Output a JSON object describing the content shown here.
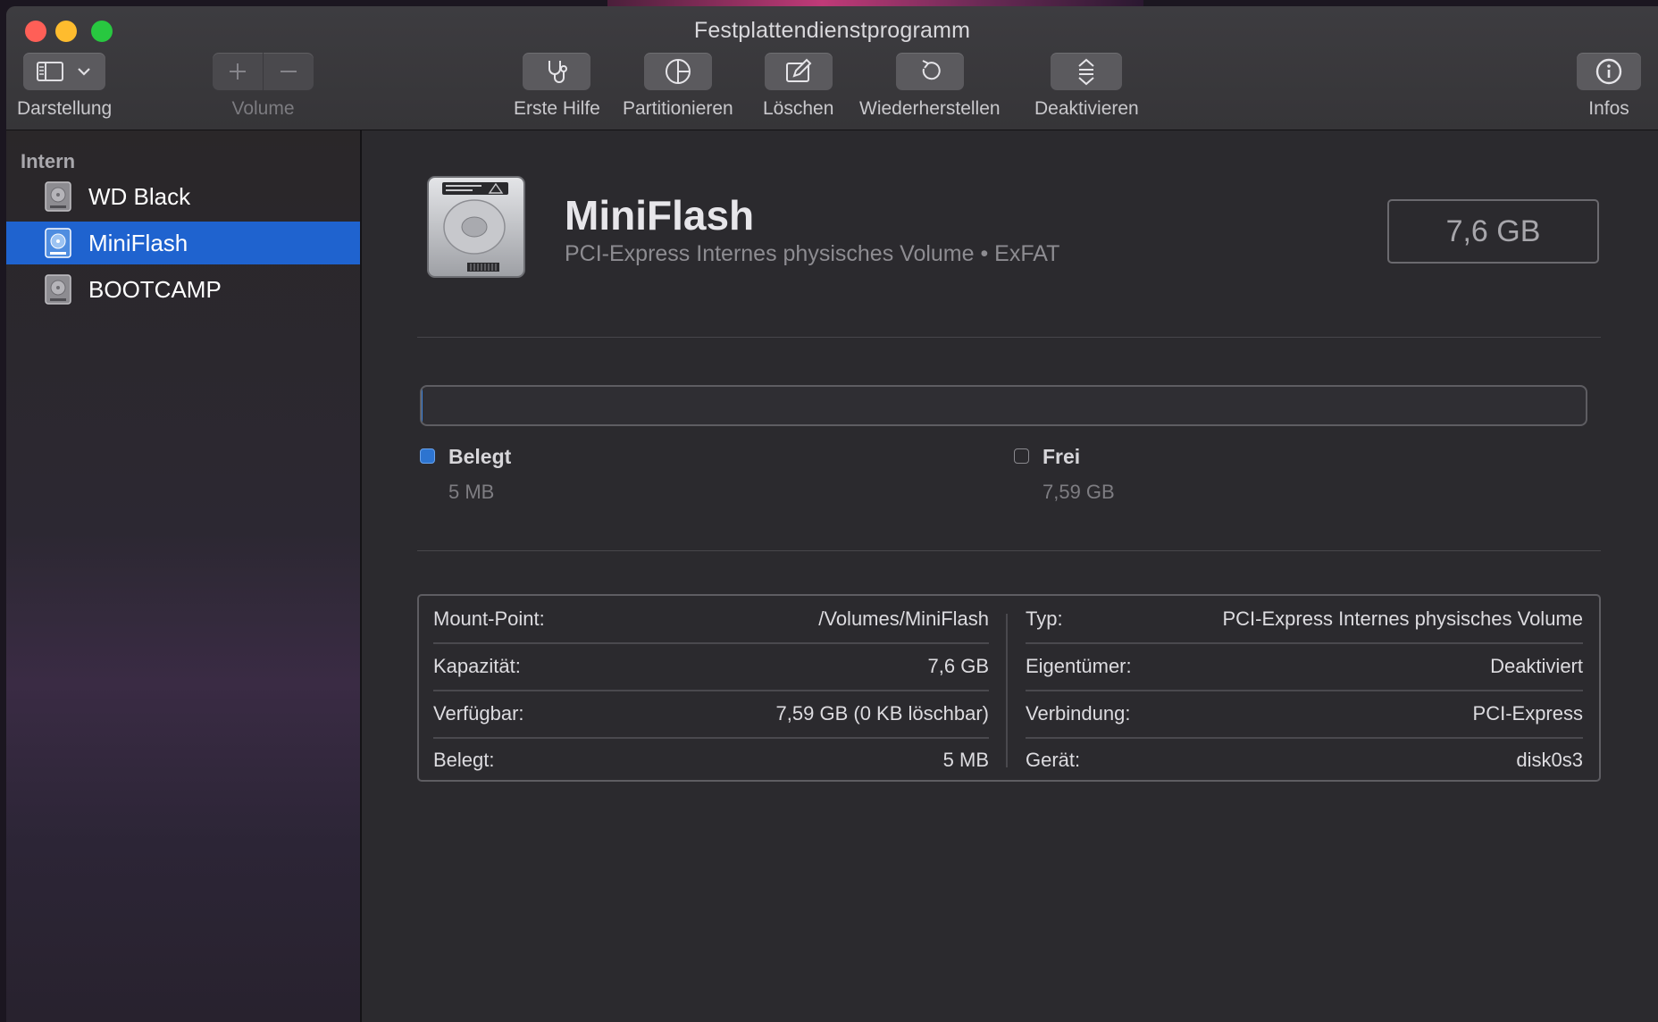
{
  "window": {
    "title": "Festplattendienstprogramm"
  },
  "toolbar": {
    "view_label": "Darstellung",
    "volume_label": "Volume",
    "first_aid_label": "Erste Hilfe",
    "partition_label": "Partitionieren",
    "erase_label": "Löschen",
    "restore_label": "Wiederherstellen",
    "unmount_label": "Deaktivieren",
    "info_label": "Infos"
  },
  "sidebar": {
    "section": "Intern",
    "items": [
      {
        "label": "WD Black",
        "selected": false
      },
      {
        "label": "MiniFlash",
        "selected": true
      },
      {
        "label": "BOOTCAMP",
        "selected": false
      }
    ]
  },
  "volume": {
    "name": "MiniFlash",
    "description": "PCI-Express Internes physisches Volume • ExFAT",
    "size": "7,6 GB"
  },
  "usage": {
    "used_fraction": 0.0007,
    "used_label": "Belegt",
    "used_value": "5 MB",
    "used_color": "#3d82d9",
    "free_label": "Frei",
    "free_value": "7,59 GB"
  },
  "info": {
    "left": [
      {
        "key": "Mount-Point:",
        "value": "/Volumes/MiniFlash"
      },
      {
        "key": "Kapazität:",
        "value": "7,6 GB"
      },
      {
        "key": "Verfügbar:",
        "value": "7,59 GB (0 KB löschbar)"
      },
      {
        "key": "Belegt:",
        "value": "5 MB"
      }
    ],
    "right": [
      {
        "key": "Typ:",
        "value": "PCI-Express Internes physisches Volume"
      },
      {
        "key": "Eigentümer:",
        "value": "Deaktiviert"
      },
      {
        "key": "Verbindung:",
        "value": "PCI-Express"
      },
      {
        "key": "Gerät:",
        "value": "disk0s3"
      }
    ]
  },
  "colors": {
    "accent": "#1f63cf",
    "close": "#ff5f57",
    "minimize": "#febc2e",
    "maximize": "#28c840"
  }
}
